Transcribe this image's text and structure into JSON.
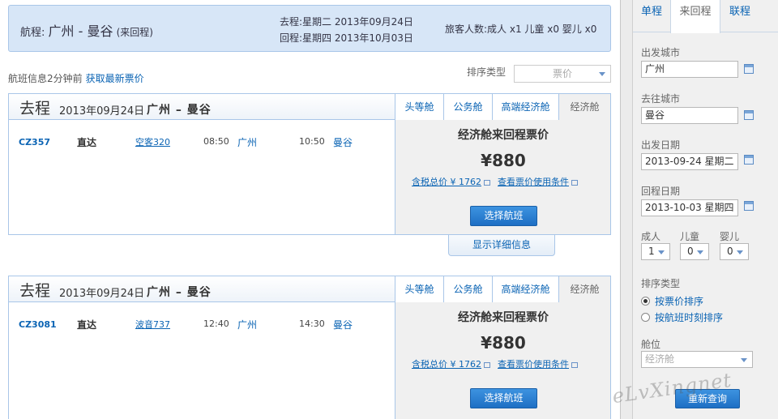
{
  "summary": {
    "route_label": "航程:",
    "route_cities": "广州 - 曼谷",
    "route_type": "(来回程)",
    "depart_line": "去程:星期二 2013年09月24日",
    "return_line": "回程:星期四 2013年10月03日",
    "passengers": "旅客人数:成人 x1 儿童 x0 婴儿 x0"
  },
  "info": {
    "updated": "航班信息2分钟前",
    "refresh_link": "获取最新票价",
    "sort_label": "排序类型",
    "sort_value": "票价"
  },
  "flights": [
    {
      "go_label": "去程",
      "date": "2013年09月24日",
      "cities": "广州 – 曼谷",
      "tabs": [
        "头等舱",
        "公务舱",
        "高端经济舱",
        "经济舱"
      ],
      "flight_no": "CZ357",
      "direct": "直达",
      "aircraft": "空客320",
      "dep_time": "08:50",
      "dep_city": "广州",
      "arr_time": "10:50",
      "arr_city": "曼谷",
      "price_title": "经济舱来回程票价",
      "price": "¥880",
      "tax_total": "含税总价 ¥ 1762",
      "conditions": "查看票价使用条件",
      "select": "选择航班"
    },
    {
      "go_label": "去程",
      "date": "2013年09月24日",
      "cities": "广州 – 曼谷",
      "tabs": [
        "头等舱",
        "公务舱",
        "高端经济舱",
        "经济舱"
      ],
      "flight_no": "CZ3081",
      "direct": "直达",
      "aircraft": "波音737",
      "dep_time": "12:40",
      "dep_city": "广州",
      "arr_time": "14:30",
      "arr_city": "曼谷",
      "price_title": "经济舱来回程票价",
      "price": "¥880",
      "tax_total": "含税总价 ¥ 1762",
      "conditions": "查看票价使用条件",
      "select": "选择航班"
    }
  ],
  "detail_button": "显示详细信息",
  "search": {
    "tabs": [
      "单程",
      "来回程",
      "联程"
    ],
    "from_label": "出发城市",
    "from_value": "广州",
    "to_label": "去往城市",
    "to_value": "曼谷",
    "depart_label": "出发日期",
    "depart_value": "2013-09-24 星期二",
    "return_label": "回程日期",
    "return_value": "2013-10-03 星期四",
    "adult_label": "成人",
    "adult_value": "1",
    "child_label": "儿童",
    "child_value": "0",
    "infant_label": "婴儿",
    "infant_value": "0",
    "sort_label": "排序类型",
    "sort_price": "按票价排序",
    "sort_time": "按航班时刻排序",
    "cabin_label": "舱位",
    "cabin_value": "经济舱",
    "search_button": "重新查询"
  },
  "watermark": "eLvXingnet"
}
